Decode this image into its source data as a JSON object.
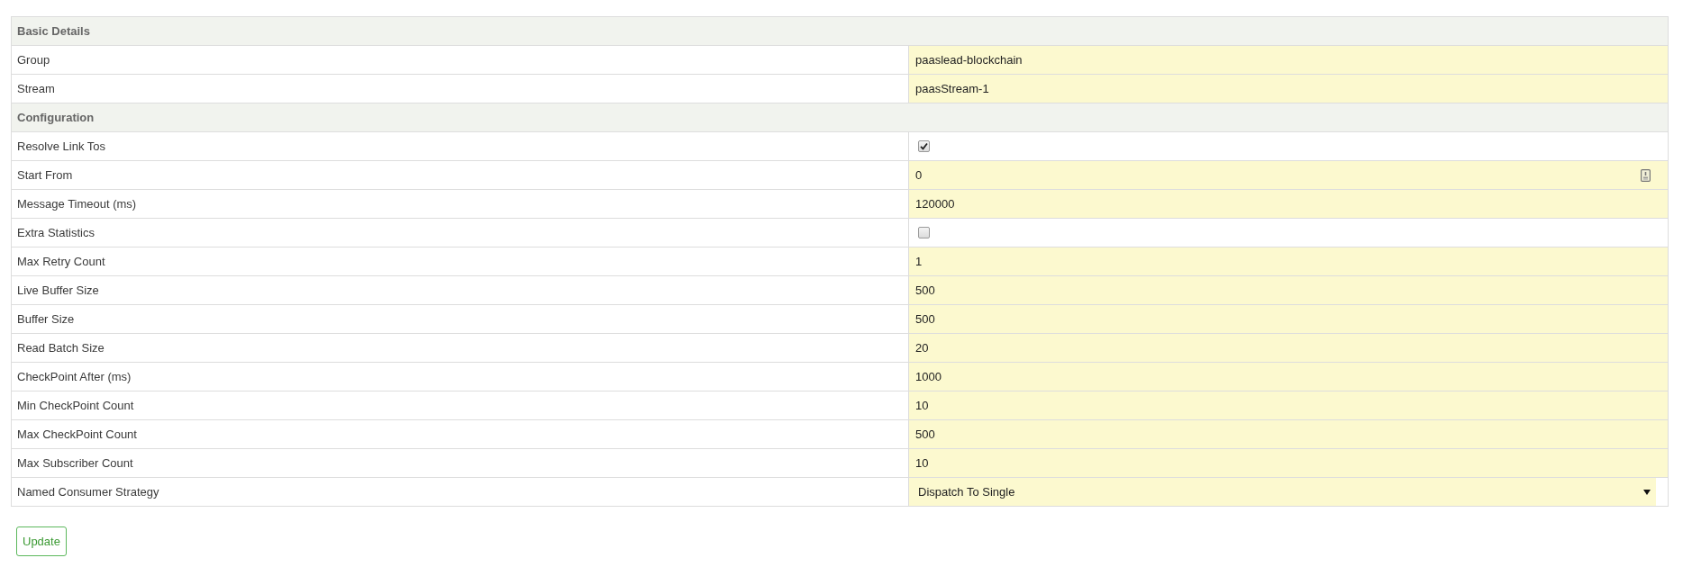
{
  "sections": [
    {
      "title": "Basic Details",
      "fields": [
        {
          "label": "Group",
          "kind": "text",
          "value": "paaslead-blockchain"
        },
        {
          "label": "Stream",
          "kind": "text",
          "value": "paasStream-1"
        }
      ]
    },
    {
      "title": "Configuration",
      "fields": [
        {
          "label": "Resolve Link Tos",
          "kind": "checkbox",
          "checked": true
        },
        {
          "label": "Start From",
          "kind": "text-icon",
          "value": "0"
        },
        {
          "label": "Message Timeout (ms)",
          "kind": "text",
          "value": "120000"
        },
        {
          "label": "Extra Statistics",
          "kind": "checkbox",
          "checked": false
        },
        {
          "label": "Max Retry Count",
          "kind": "text",
          "value": "1"
        },
        {
          "label": "Live Buffer Size",
          "kind": "text",
          "value": "500"
        },
        {
          "label": "Buffer Size",
          "kind": "text",
          "value": "500"
        },
        {
          "label": "Read Batch Size",
          "kind": "text",
          "value": "20"
        },
        {
          "label": "CheckPoint After (ms)",
          "kind": "text",
          "value": "1000"
        },
        {
          "label": "Min CheckPoint Count",
          "kind": "text",
          "value": "10"
        },
        {
          "label": "Max CheckPoint Count",
          "kind": "text",
          "value": "500"
        },
        {
          "label": "Max Subscriber Count",
          "kind": "text",
          "value": "10"
        },
        {
          "label": "Named Consumer Strategy",
          "kind": "select",
          "value": "Dispatch To Single"
        }
      ]
    }
  ],
  "update_button": "Update"
}
